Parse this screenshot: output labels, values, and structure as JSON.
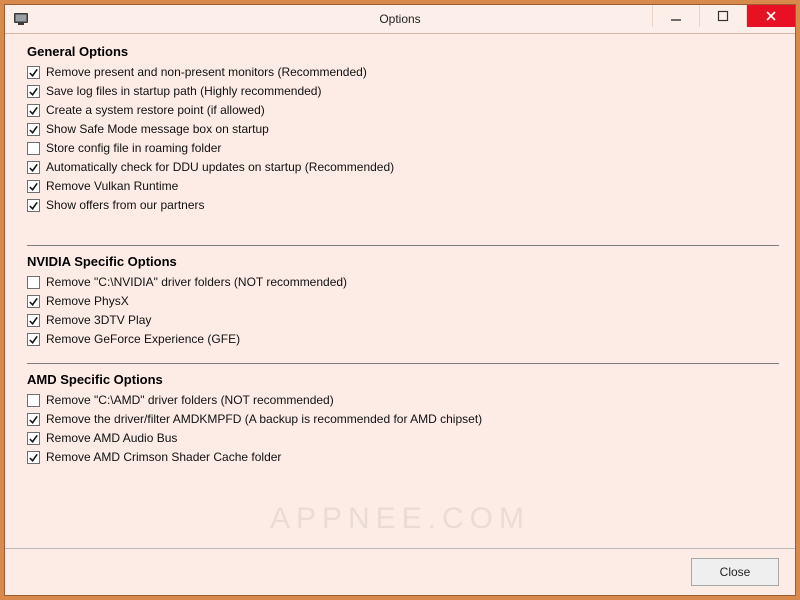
{
  "window": {
    "title": "Options",
    "close_button": "Close"
  },
  "sections": {
    "general": {
      "heading": "General Options",
      "items": [
        {
          "label": "Remove present and non-present monitors (Recommended)",
          "checked": true
        },
        {
          "label": "Save log files in startup path (Highly recommended)",
          "checked": true
        },
        {
          "label": "Create a system restore point (if allowed)",
          "checked": true
        },
        {
          "label": "Show Safe Mode message box on startup",
          "checked": true
        },
        {
          "label": "Store config file in roaming folder",
          "checked": false
        },
        {
          "label": "Automatically check for DDU updates on startup (Recommended)",
          "checked": true
        },
        {
          "label": "Remove Vulkan Runtime",
          "checked": true
        },
        {
          "label": "Show offers from our partners",
          "checked": true
        }
      ]
    },
    "nvidia": {
      "heading": "NVIDIA Specific Options",
      "items": [
        {
          "label": "Remove \"C:\\NVIDIA\" driver folders (NOT recommended)",
          "checked": false
        },
        {
          "label": "Remove PhysX",
          "checked": true
        },
        {
          "label": "Remove 3DTV Play",
          "checked": true
        },
        {
          "label": "Remove GeForce Experience (GFE)",
          "checked": true
        }
      ]
    },
    "amd": {
      "heading": "AMD Specific Options",
      "items": [
        {
          "label": "Remove \"C:\\AMD\" driver folders (NOT recommended)",
          "checked": false
        },
        {
          "label": "Remove the driver/filter AMDKMPFD (A backup is recommended for AMD chipset)",
          "checked": true
        },
        {
          "label": "Remove AMD Audio Bus",
          "checked": true
        },
        {
          "label": "Remove AMD Crimson Shader Cache folder",
          "checked": true
        }
      ]
    }
  },
  "watermark": "APPNEE.COM"
}
